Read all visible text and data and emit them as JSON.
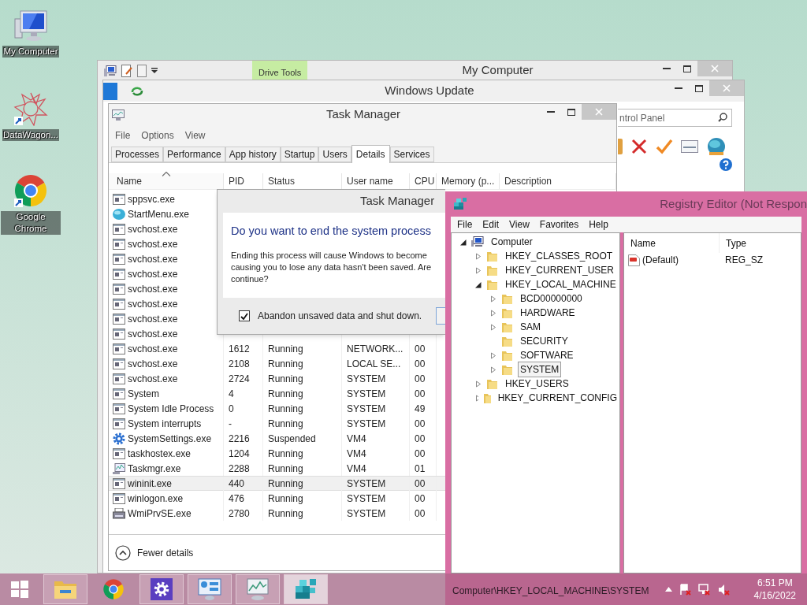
{
  "desktop_icons": [
    {
      "kind": "computer",
      "label": "My Computer"
    },
    {
      "kind": "star",
      "label": "DataWagon..."
    },
    {
      "kind": "chrome",
      "label": "Google Chrome"
    }
  ],
  "my_computer_window": {
    "title": "My Computer",
    "ribbon_tab": "Drive Tools"
  },
  "windows_update_window": {
    "title": "Windows Update",
    "search": {
      "placeholder": "ntrol Panel"
    }
  },
  "task_manager": {
    "title": "Task Manager",
    "menu": [
      "File",
      "Options",
      "View"
    ],
    "tabs": [
      {
        "label": "Processes",
        "selected": false
      },
      {
        "label": "Performance",
        "selected": false
      },
      {
        "label": "App history",
        "selected": false
      },
      {
        "label": "Startup",
        "selected": false
      },
      {
        "label": "Users",
        "selected": false
      },
      {
        "label": "Details",
        "selected": true
      },
      {
        "label": "Services",
        "selected": false
      }
    ],
    "columns": [
      {
        "label": "Name",
        "sorted": true
      },
      {
        "label": "PID",
        "sorted": false
      },
      {
        "label": "Status",
        "sorted": false
      },
      {
        "label": "User name",
        "sorted": false
      },
      {
        "label": "CPU",
        "sorted": false
      },
      {
        "label": "Memory (p...",
        "sorted": false
      },
      {
        "label": "Description",
        "sorted": false
      }
    ],
    "rows": [
      {
        "kind": "app",
        "name": "sppsvc.exe",
        "selected": false
      },
      {
        "kind": "globe",
        "name": "StartMenu.exe",
        "selected": false
      },
      {
        "kind": "app",
        "name": "svchost.exe",
        "selected": false
      },
      {
        "kind": "app",
        "name": "svchost.exe",
        "selected": false
      },
      {
        "kind": "app",
        "name": "svchost.exe",
        "selected": false
      },
      {
        "kind": "app",
        "name": "svchost.exe",
        "selected": false
      },
      {
        "kind": "app",
        "name": "svchost.exe",
        "selected": false
      },
      {
        "kind": "app",
        "name": "svchost.exe",
        "selected": false
      },
      {
        "kind": "app",
        "name": "svchost.exe",
        "selected": false
      },
      {
        "kind": "app",
        "name": "svchost.exe",
        "selected": false
      },
      {
        "kind": "app",
        "name": "svchost.exe",
        "pid": "1612",
        "status": "Running",
        "user": "NETWORK...",
        "cpu": "00",
        "selected": false
      },
      {
        "kind": "app",
        "name": "svchost.exe",
        "pid": "2108",
        "status": "Running",
        "user": "LOCAL SE...",
        "cpu": "00",
        "selected": false
      },
      {
        "kind": "app",
        "name": "svchost.exe",
        "pid": "2724",
        "status": "Running",
        "user": "SYSTEM",
        "cpu": "00",
        "selected": false
      },
      {
        "kind": "app",
        "name": "System",
        "pid": "4",
        "status": "Running",
        "user": "SYSTEM",
        "cpu": "00",
        "selected": false
      },
      {
        "kind": "app",
        "name": "System Idle Process",
        "pid": "0",
        "status": "Running",
        "user": "SYSTEM",
        "cpu": "49",
        "selected": false
      },
      {
        "kind": "app",
        "name": "System interrupts",
        "pid": "-",
        "status": "Running",
        "user": "SYSTEM",
        "cpu": "00",
        "selected": false
      },
      {
        "kind": "gear",
        "name": "SystemSettings.exe",
        "pid": "2216",
        "status": "Suspended",
        "user": "VM4",
        "cpu": "00",
        "selected": false
      },
      {
        "kind": "app",
        "name": "taskhostex.exe",
        "pid": "1204",
        "status": "Running",
        "user": "VM4",
        "cpu": "00",
        "selected": false
      },
      {
        "kind": "monitor",
        "name": "Taskmgr.exe",
        "pid": "2288",
        "status": "Running",
        "user": "VM4",
        "cpu": "01",
        "selected": false
      },
      {
        "kind": "app",
        "name": "wininit.exe",
        "pid": "440",
        "status": "Running",
        "user": "SYSTEM",
        "cpu": "00",
        "selected": true
      },
      {
        "kind": "app",
        "name": "winlogon.exe",
        "pid": "476",
        "status": "Running",
        "user": "SYSTEM",
        "cpu": "00",
        "selected": false
      },
      {
        "kind": "printer",
        "name": "WmiPrvSE.exe",
        "pid": "2780",
        "status": "Running",
        "user": "SYSTEM",
        "cpu": "00",
        "selected": false
      }
    ],
    "footer": "Fewer details"
  },
  "dialog": {
    "title": "Task Manager",
    "heading": "Do you want to end the system process",
    "message": "Ending this process will cause Windows to become\ncausing you to lose any data hasn't been saved. Are\ncontinue?",
    "checkbox": {
      "label": "Abandon unsaved data and shut down.",
      "checked": true
    }
  },
  "registry_editor": {
    "title": "Registry Editor (Not Respon",
    "menu": [
      "File",
      "Edit",
      "View",
      "Favorites",
      "Help"
    ],
    "tree": [
      {
        "kind": "computer",
        "label": "Computer",
        "expandable": true,
        "expanded": true,
        "selected": false,
        "children": [
          {
            "kind": "folder",
            "label": "HKEY_CLASSES_ROOT",
            "expandable": true,
            "expanded": false,
            "selected": false
          },
          {
            "kind": "folder",
            "label": "HKEY_CURRENT_USER",
            "expandable": true,
            "expanded": false,
            "selected": false
          },
          {
            "kind": "folder",
            "label": "HKEY_LOCAL_MACHINE",
            "expandable": true,
            "expanded": true,
            "selected": false,
            "children": [
              {
                "kind": "folder",
                "label": "BCD00000000",
                "expandable": true,
                "expanded": false,
                "selected": false
              },
              {
                "kind": "folder",
                "label": "HARDWARE",
                "expandable": true,
                "expanded": false,
                "selected": false
              },
              {
                "kind": "folder",
                "label": "SAM",
                "expandable": true,
                "expanded": false,
                "selected": false
              },
              {
                "kind": "folder",
                "label": "SECURITY",
                "expandable": false,
                "expanded": false,
                "selected": false
              },
              {
                "kind": "folder",
                "label": "SOFTWARE",
                "expandable": true,
                "expanded": false,
                "selected": false
              },
              {
                "kind": "folder",
                "label": "SYSTEM",
                "expandable": true,
                "expanded": false,
                "selected": true
              }
            ]
          },
          {
            "kind": "folder",
            "label": "HKEY_USERS",
            "expandable": true,
            "expanded": false,
            "selected": false
          },
          {
            "kind": "folder",
            "label": "HKEY_CURRENT_CONFIG",
            "expandable": true,
            "expanded": false,
            "selected": false
          }
        ]
      }
    ],
    "columns": [
      "Name",
      "Type"
    ],
    "values": [
      {
        "name": "(Default)",
        "type": "REG_SZ"
      }
    ],
    "status_bar": "Computer\\HKEY_LOCAL_MACHINE\\SYSTEM"
  },
  "taskbar": {
    "buttons": [
      {
        "kind": "start",
        "running": false,
        "selected": false
      },
      {
        "kind": "folder",
        "running": true,
        "selected": false
      },
      {
        "kind": "chrome",
        "running": false,
        "selected": false
      },
      {
        "kind": "settings",
        "running": true,
        "selected": false
      },
      {
        "kind": "control",
        "running": true,
        "selected": false
      },
      {
        "kind": "monitor",
        "running": true,
        "selected": false
      },
      {
        "kind": "registry",
        "running": true,
        "selected": true
      }
    ],
    "time": "6:51 PM",
    "date": "4/16/2022"
  }
}
